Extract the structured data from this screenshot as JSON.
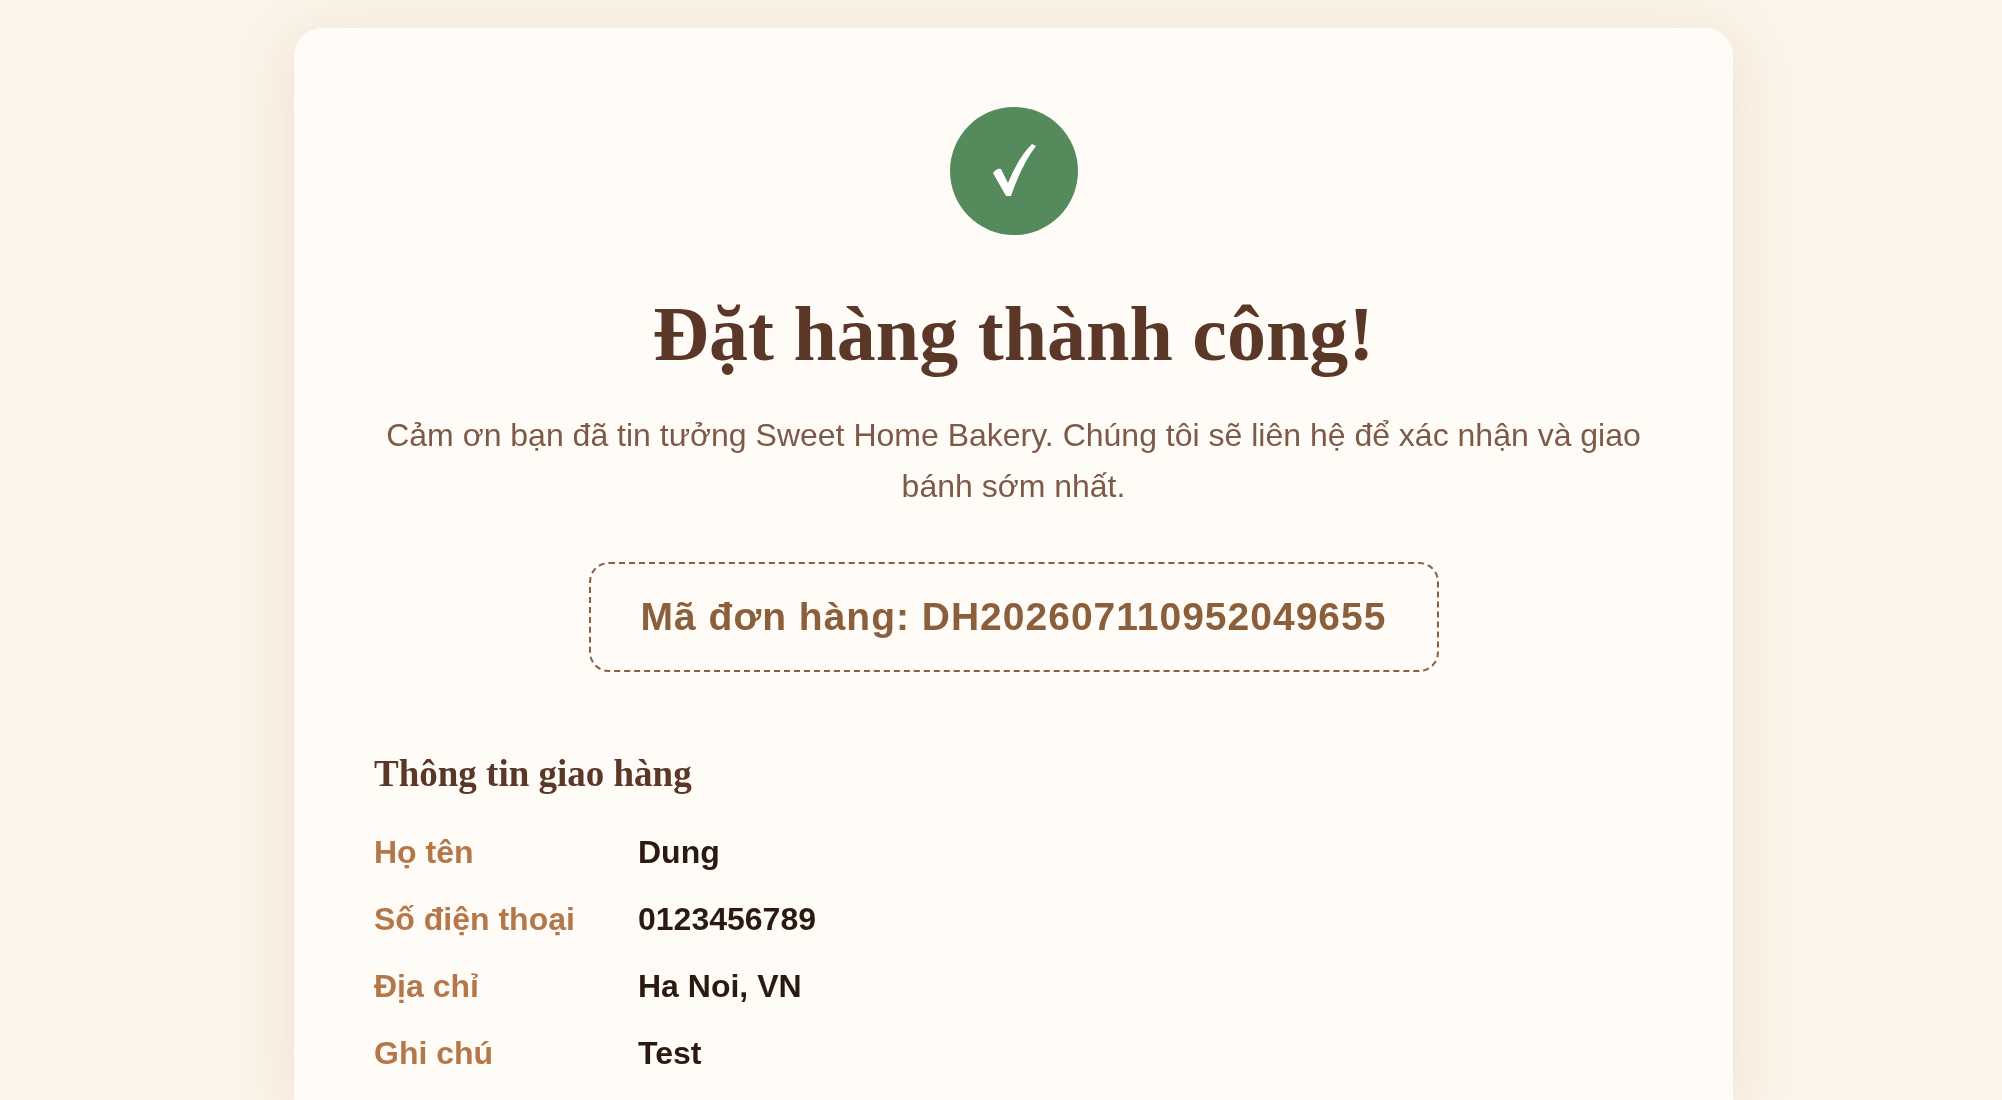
{
  "confirmation": {
    "title": "Đặt hàng thành công!",
    "message": "Cảm ơn bạn đã tin tưởng Sweet Home Bakery. Chúng tôi sẽ liên hệ để xác nhận và giao bánh sớm nhất.",
    "order_code": "Mã đơn hàng: DH202607110952049655"
  },
  "delivery_info": {
    "heading": "Thông tin giao hàng",
    "fields": [
      {
        "label": "Họ tên",
        "value": "Dung"
      },
      {
        "label": "Số điện thoại",
        "value": "0123456789"
      },
      {
        "label": "Địa chỉ",
        "value": "Ha Noi, VN"
      },
      {
        "label": "Ghi chú",
        "value": "Test"
      }
    ]
  }
}
